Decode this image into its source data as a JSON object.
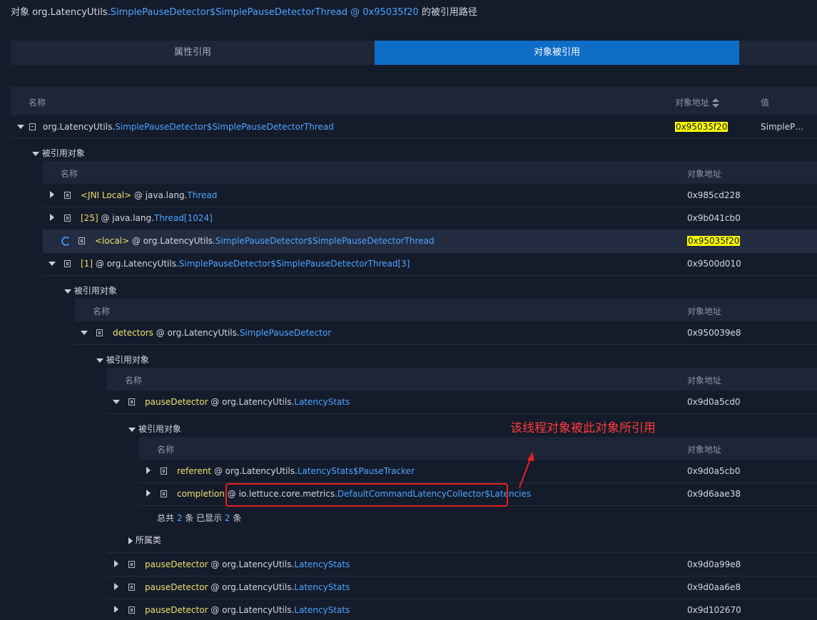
{
  "title": {
    "prefix": "对象 org.LatencyUtils.",
    "cls": "SimplePauseDetector$SimplePauseDetectorThread",
    "at": " @ ",
    "addr": "0x95035f20",
    "suffix": " 的被引用路径"
  },
  "tabs": {
    "attr_ref": "属性引用",
    "obj_ref": "对象被引用"
  },
  "main_header": {
    "name": "名称",
    "addr": "对象地址",
    "value": "值"
  },
  "root": {
    "pkg": "org.LatencyUtils.",
    "cls": "SimplePauseDetector$SimplePauseDetectorThread",
    "addr": "0x95035f20",
    "value": "SimpleP…"
  },
  "referenced_label": "被引用对象",
  "sub_header": {
    "name": "名称",
    "addr": "对象地址"
  },
  "level1": [
    {
      "field": "<JNI Local>",
      "mid": " @ java.lang.",
      "cls": "Thread",
      "addr": "0x985cd228"
    },
    {
      "field": "[25]",
      "mid": " @ java.lang.",
      "cls": "Thread[1024]",
      "addr": "0x9b041cb0"
    },
    {
      "field": "<local>",
      "mid": " @ org.LatencyUtils.",
      "cls": "SimplePauseDetector$SimplePauseDetectorThread",
      "addr": "0x95035f20"
    },
    {
      "field": "[1]",
      "mid": " @ org.LatencyUtils.",
      "cls": "SimplePauseDetector$SimplePauseDetectorThread[3]",
      "addr": "0x9500d010"
    }
  ],
  "level2": [
    {
      "field": "detectors",
      "mid": " @ org.LatencyUtils.",
      "cls": "SimplePauseDetector",
      "addr": "0x950039e8"
    }
  ],
  "level3": [
    {
      "field": "pauseDetector",
      "mid": " @ org.LatencyUtils.",
      "cls": "LatencyStats",
      "addr": "0x9d0a5cd0"
    },
    {
      "field": "pauseDetector",
      "mid": " @ org.LatencyUtils.",
      "cls": "LatencyStats",
      "addr": "0x9d0a99e8"
    },
    {
      "field": "pauseDetector",
      "mid": " @ org.LatencyUtils.",
      "cls": "LatencyStats",
      "addr": "0x9d0aa6e8"
    },
    {
      "field": "pauseDetector",
      "mid": " @ org.LatencyUtils.",
      "cls": "LatencyStats",
      "addr": "0x9d102670"
    }
  ],
  "level4": [
    {
      "field": "referent",
      "mid": " @ org.LatencyUtils.",
      "cls": "LatencyStats$PauseTracker",
      "addr": "0x9d0a5cb0"
    },
    {
      "field": "completion",
      "mid": " @ io.lettuce.core.metrics.",
      "cls": "DefaultCommandLatencyCollector$Latencies",
      "addr": "0x9d6aae38"
    }
  ],
  "footer": {
    "total_label": "总共 ",
    "total": "2",
    "unit1": " 条  已显示 ",
    "shown": "2",
    "unit2": " 条"
  },
  "class_label": "所属类",
  "annotation": "该线程对象被此对象所引用",
  "colors": {
    "accent": "#0e6dc7",
    "link": "#4da6ff",
    "field": "#f0e068",
    "highlight": "#ffff00",
    "annotation": "#ff3b3b"
  }
}
